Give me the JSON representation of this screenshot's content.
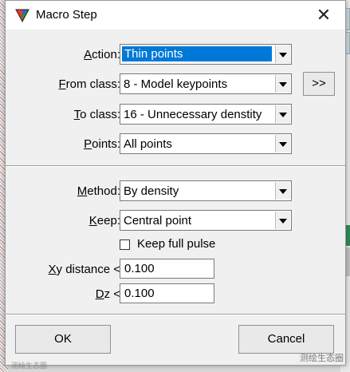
{
  "window": {
    "title": "Macro Step",
    "close_glyph": "✕"
  },
  "fields": {
    "action": {
      "label": "Action:",
      "mnemonic": "A",
      "rest": "ction:",
      "value": "Thin points"
    },
    "from_class": {
      "label": "From class:",
      "mnemonic": "F",
      "rest": "rom class:",
      "value": "8 - Model keypoints"
    },
    "to_class": {
      "label": "To class:",
      "mnemonic": "T",
      "rest": "o class:",
      "value": "16 - Unnecessary denstity"
    },
    "points": {
      "label": "Points:",
      "mnemonic": "P",
      "rest": "oints:",
      "value": "All points"
    },
    "method": {
      "label": "Method:",
      "mnemonic": "M",
      "rest": "ethod:",
      "value": "By density"
    },
    "keep": {
      "label": "Keep:",
      "mnemonic": "K",
      "rest": "eep:",
      "value": "Central point"
    },
    "keep_full_pulse": {
      "label": "Keep full pulse",
      "checked": false
    },
    "xy_distance": {
      "label": "Xy distance <",
      "mnemonic": "X",
      "rest": "y distance <",
      "value": "0.100"
    },
    "dz": {
      "label": "Dz <",
      "mnemonic": "D",
      "rest": "z <",
      "value": "0.100"
    }
  },
  "buttons": {
    "more": ">>",
    "ok": "OK",
    "cancel": "Cancel"
  },
  "colors": {
    "selection": "#0078d7",
    "dialog_bg": "#f0f0f0"
  },
  "icons": {
    "app": "terrasolid-triangle-icon",
    "close": "close-icon",
    "dropdown": "chevron-down-icon"
  },
  "watermark": {
    "text": "测绘生态圈",
    "left_text": "测绘生态圈"
  }
}
